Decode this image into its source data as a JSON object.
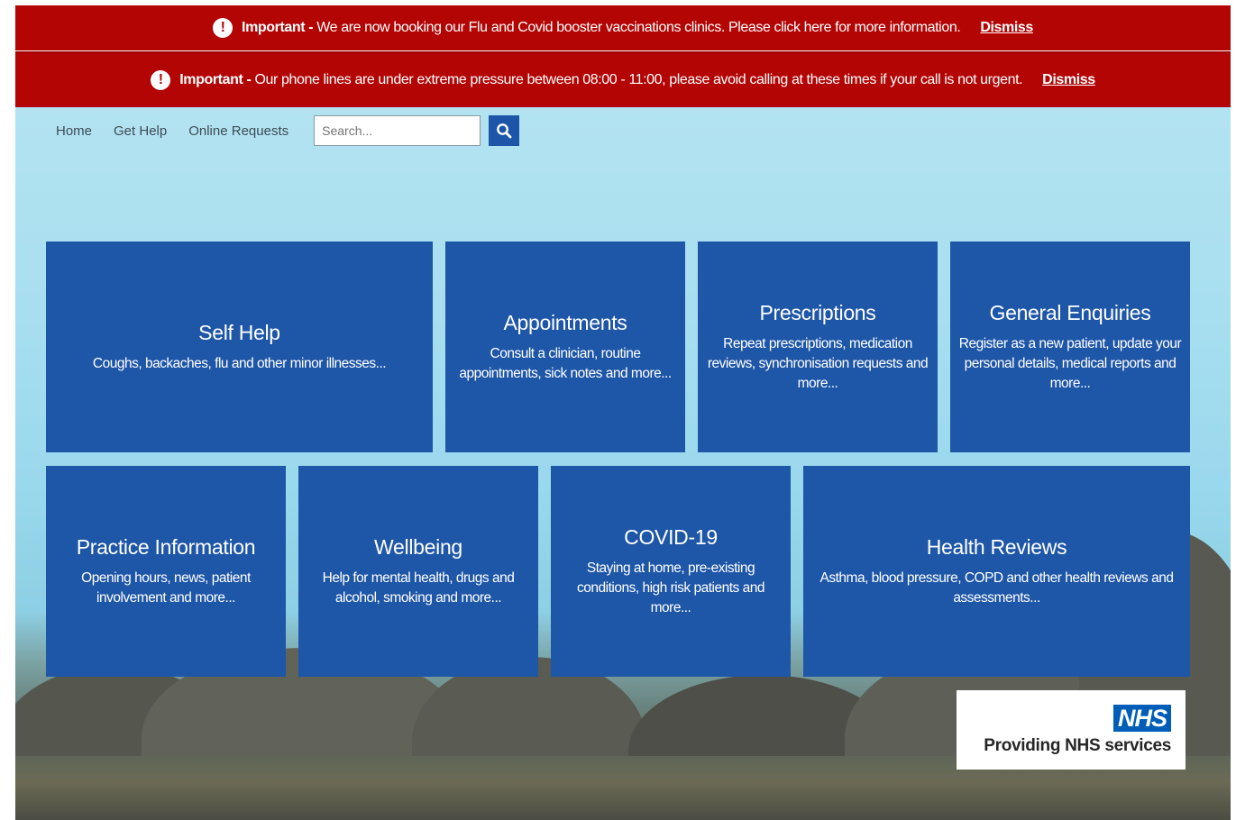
{
  "alerts": [
    {
      "label": "Important -",
      "message": "We are now booking our Flu and Covid booster vaccinations clinics. Please click here for more information.",
      "dismiss": "Dismiss",
      "icon": "exclamation-circle-icon"
    },
    {
      "label": "Important -",
      "message": "Our phone lines are under extreme pressure between 08:00 - 11:00, please avoid calling at these times if your call is not urgent.",
      "dismiss": "Dismiss",
      "icon": "exclamation-circle-icon"
    }
  ],
  "nav": {
    "items": [
      "Home",
      "Get Help",
      "Online Requests"
    ],
    "search_placeholder": "Search...",
    "search_icon": "search-icon"
  },
  "tiles": [
    {
      "title": "Self Help",
      "desc": "Coughs, backaches, flu and other minor illnesses..."
    },
    {
      "title": "Appointments",
      "desc": "Consult a clinician, routine appointments, sick notes and more..."
    },
    {
      "title": "Prescriptions",
      "desc": "Repeat prescriptions, medication reviews, synchronisation requests and more..."
    },
    {
      "title": "General Enquiries",
      "desc": "Register as a new patient, update your personal details, medical reports and more..."
    },
    {
      "title": "Practice Information",
      "desc": "Opening hours, news, patient involvement and more..."
    },
    {
      "title": "Wellbeing",
      "desc": "Help for mental health, drugs and alcohol, smoking and more..."
    },
    {
      "title": "COVID-19",
      "desc": "Staying at home, pre-existing conditions, high risk patients and more..."
    },
    {
      "title": "Health Reviews",
      "desc": "Asthma, blood pressure, COPD and other health reviews and assessments..."
    }
  ],
  "nhs_badge": {
    "logo": "NHS",
    "text": "Providing NHS services"
  },
  "colors": {
    "alert_bg": "#b40505",
    "tile_bg": "#1e56a8",
    "nhs_blue": "#005eb8"
  }
}
